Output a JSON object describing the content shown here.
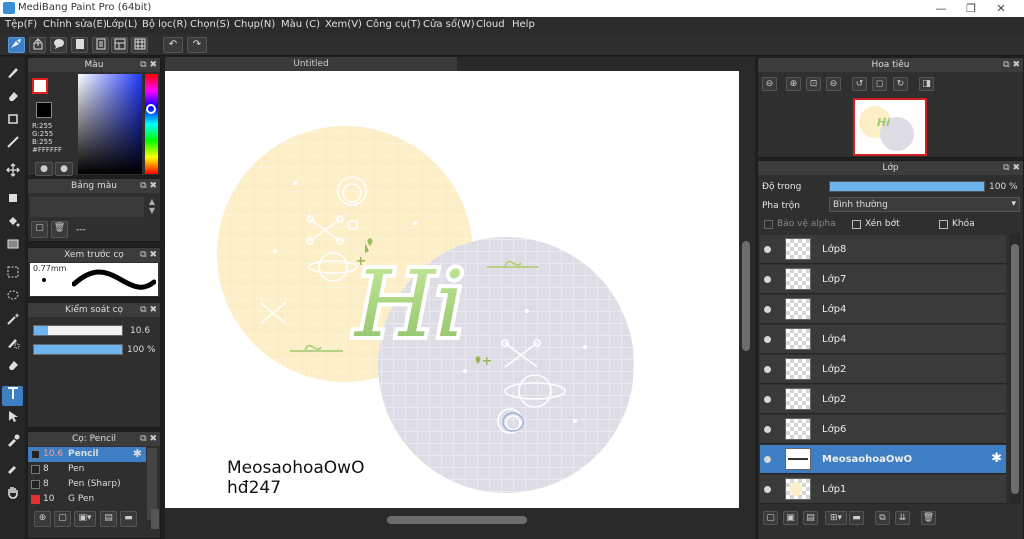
{
  "window": {
    "title": "MediBang Paint Pro (64bit)",
    "minimize": "—",
    "restore": "❐",
    "close": "✕"
  },
  "menu": [
    "Tệp(F)",
    "Chỉnh sửa(E)",
    "Lớp(L)",
    "Bộ lọc(R)",
    "Chọn(S)",
    "Chụp(N)",
    "Màu (C)",
    "Xem(V)",
    "Công cụ(T)",
    "Cửa sổ(W)",
    "Cloud",
    "Help"
  ],
  "toolbar": {
    "icons": [
      "brush-mode-icon",
      "share-icon",
      "comment-icon",
      "page-icon",
      "page-manage-icon",
      "panels-icon",
      "grid-icon"
    ],
    "undo_icon": "↶",
    "redo_icon": "↷"
  },
  "tools": [
    "pen-tool-icon",
    "eraser-tool-icon",
    "rectangle-tool-icon",
    "line-tool-icon",
    "move-tool-icon",
    "fill-rect-tool-icon",
    "bucket-tool-icon",
    "gradient-tool-icon",
    "select-tool-icon",
    "lasso-tool-icon",
    "magic-wand-tool-icon",
    "select-pen-tool-icon",
    "select-eraser-tool-icon",
    "text-tool-icon",
    "operation-tool-icon",
    "dropper-tool-icon",
    "hand-tool-icon"
  ],
  "color_panel": {
    "title": "Màu",
    "rgb": [
      "R:255",
      "G:255",
      "B:255"
    ],
    "hex": "#FFFFFF",
    "primary_color": "#ffffff",
    "secondary_color": "#000000"
  },
  "palette_panel": {
    "title": "Bảng màu",
    "value": "---"
  },
  "brush_preview": {
    "title": "Xem trước cọ",
    "size": "0.77mm"
  },
  "brush_control": {
    "title": "Kiểm soát cọ",
    "size_value": "10.6",
    "size_fraction": 0.16,
    "opacity_value": "100 %",
    "opacity_fraction": 1.0
  },
  "brush_panel": {
    "title": "Cọ: Pencil",
    "brushes": [
      {
        "size": "10.6",
        "name": "Pencil",
        "color": "#222222",
        "selected": true
      },
      {
        "size": "8",
        "name": "Pen",
        "color": "#222222",
        "selected": false
      },
      {
        "size": "8",
        "name": "Pen (Sharp)",
        "color": "#222222",
        "selected": false
      },
      {
        "size": "10",
        "name": "G Pen",
        "color": "#e03030",
        "selected": false
      }
    ]
  },
  "document": {
    "tab": "Untitled",
    "text_line1": "MeosaohoaOwO",
    "text_line2": "hđ247",
    "hi_text": "Hi",
    "yellow": "#fcefc8",
    "lavender": "#dedde6"
  },
  "navigator": {
    "title": "Hoa tiêu",
    "icons": [
      "zoom-out-icon",
      "zoom-in-icon",
      "fit-icon",
      "zoom-small-icon",
      "rotate-left-icon",
      "fullscreen-icon",
      "rotate-right-icon",
      "flip-icon"
    ]
  },
  "layer_panel": {
    "title": "Lớp",
    "opacity_label": "Độ trong",
    "opacity_value": "100 %",
    "opacity_fraction": 1.0,
    "blend_label": "Pha trộn",
    "blend_value": "Bình thường",
    "protect_alpha": "Bảo vệ alpha",
    "clipping": "Xén bớt",
    "lock": "Khóa",
    "layers": [
      {
        "name": "Lớp8",
        "selected": false
      },
      {
        "name": "Lớp7",
        "selected": false
      },
      {
        "name": "Lớp4",
        "selected": false
      },
      {
        "name": "Lớp4",
        "selected": false
      },
      {
        "name": "Lớp2",
        "selected": false
      },
      {
        "name": "Lớp2",
        "selected": false
      },
      {
        "name": "Lớp6",
        "selected": false
      },
      {
        "name": "MeosaohoaOwO",
        "selected": true
      },
      {
        "name": "Lớp1",
        "selected": false
      }
    ]
  }
}
